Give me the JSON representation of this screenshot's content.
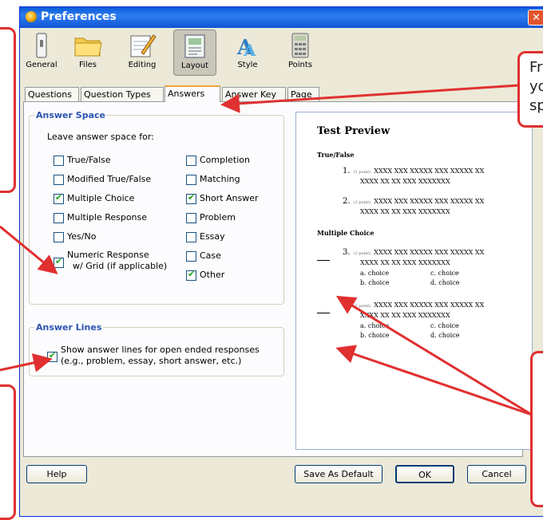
{
  "window": {
    "title": "Preferences",
    "close_glyph": "✕"
  },
  "toolbar": {
    "buttons": [
      {
        "label": "General",
        "icon": "switch-icon"
      },
      {
        "label": "Files",
        "icon": "folder-icon"
      },
      {
        "label": "Editing",
        "icon": "notepad-pencil-icon"
      },
      {
        "label": "Layout",
        "icon": "layout-icon",
        "selected": true
      },
      {
        "label": "Style",
        "icon": "font-style-icon"
      },
      {
        "label": "Points",
        "icon": "calculator-icon"
      }
    ]
  },
  "tabs": [
    {
      "label": "Questions"
    },
    {
      "label": "Question Types"
    },
    {
      "label": "Answers",
      "active": true
    },
    {
      "label": "Answer Key"
    },
    {
      "label": "Page"
    }
  ],
  "answer_space": {
    "legend": "Answer Space",
    "intro": "Leave answer space for:",
    "left": [
      {
        "label": "True/False",
        "checked": false
      },
      {
        "label": "Modified True/False",
        "checked": false
      },
      {
        "label": "Multiple Choice",
        "checked": true
      },
      {
        "label": "Multiple Response",
        "checked": false
      },
      {
        "label": "Yes/No",
        "checked": false
      },
      {
        "label1": "Numeric Response",
        "label2": "w/ Grid (if applicable)",
        "checked": true
      }
    ],
    "right": [
      {
        "label": "Completion",
        "checked": false
      },
      {
        "label": "Matching",
        "checked": false
      },
      {
        "label": "Short Answer",
        "checked": true
      },
      {
        "label": "Problem",
        "checked": false
      },
      {
        "label": "Essay",
        "checked": false
      },
      {
        "label": "Case",
        "checked": false
      },
      {
        "label": "Other",
        "checked": true
      }
    ]
  },
  "answer_lines": {
    "legend": "Answer Lines",
    "checked": true,
    "line1": "Show answer lines for open ended responses",
    "line2": "(e.g., problem, essay, short answer, etc.)"
  },
  "preview": {
    "title": "Test Preview",
    "sections": [
      {
        "heading": "True/False",
        "questions": [
          {
            "num": "1.",
            "points": "(1 point)",
            "line1": "XXXX XXX XXXXX XXX XXXXX XX",
            "line2": "XXXX XX XX XXX XXXXXXX"
          },
          {
            "num": "2.",
            "points": "(1 point)",
            "line1": "XXXX XXX XXXXX XXX XXXXX XX",
            "line2": "XXXX XX XX XXX XXXXXXX"
          }
        ]
      },
      {
        "heading": "Multiple Choice",
        "questions": [
          {
            "num": "3.",
            "points": "(1 point)",
            "line1": "XXXX XXX XXXXX XXX XXXXX XX",
            "line2": "XXXX XX XX XXX XXXXXXX",
            "choices": [
              "a. choice",
              "c. choice",
              "b. choice",
              "d. choice"
            ]
          },
          {
            "num": "4.",
            "points": "(1 point)",
            "line1": "XXXX XXX XXXXX XXX XXXXX XX",
            "line2": "XXXX XX XX XXX XXXXXXX",
            "choices": [
              "a. choice",
              "c. choice",
              "b. choice",
              "d. choice"
            ]
          }
        ]
      }
    ]
  },
  "buttons": {
    "help": "Help",
    "save_default": "Save As Default",
    "ok": "OK",
    "cancel": "Cancel"
  },
  "callout": {
    "text1": "Fr",
    "text2": "yo",
    "text3": "sp"
  },
  "colors": {
    "accent": "#e03030",
    "title_bar": "#0a5bd9",
    "legend": "#2b53b0"
  }
}
